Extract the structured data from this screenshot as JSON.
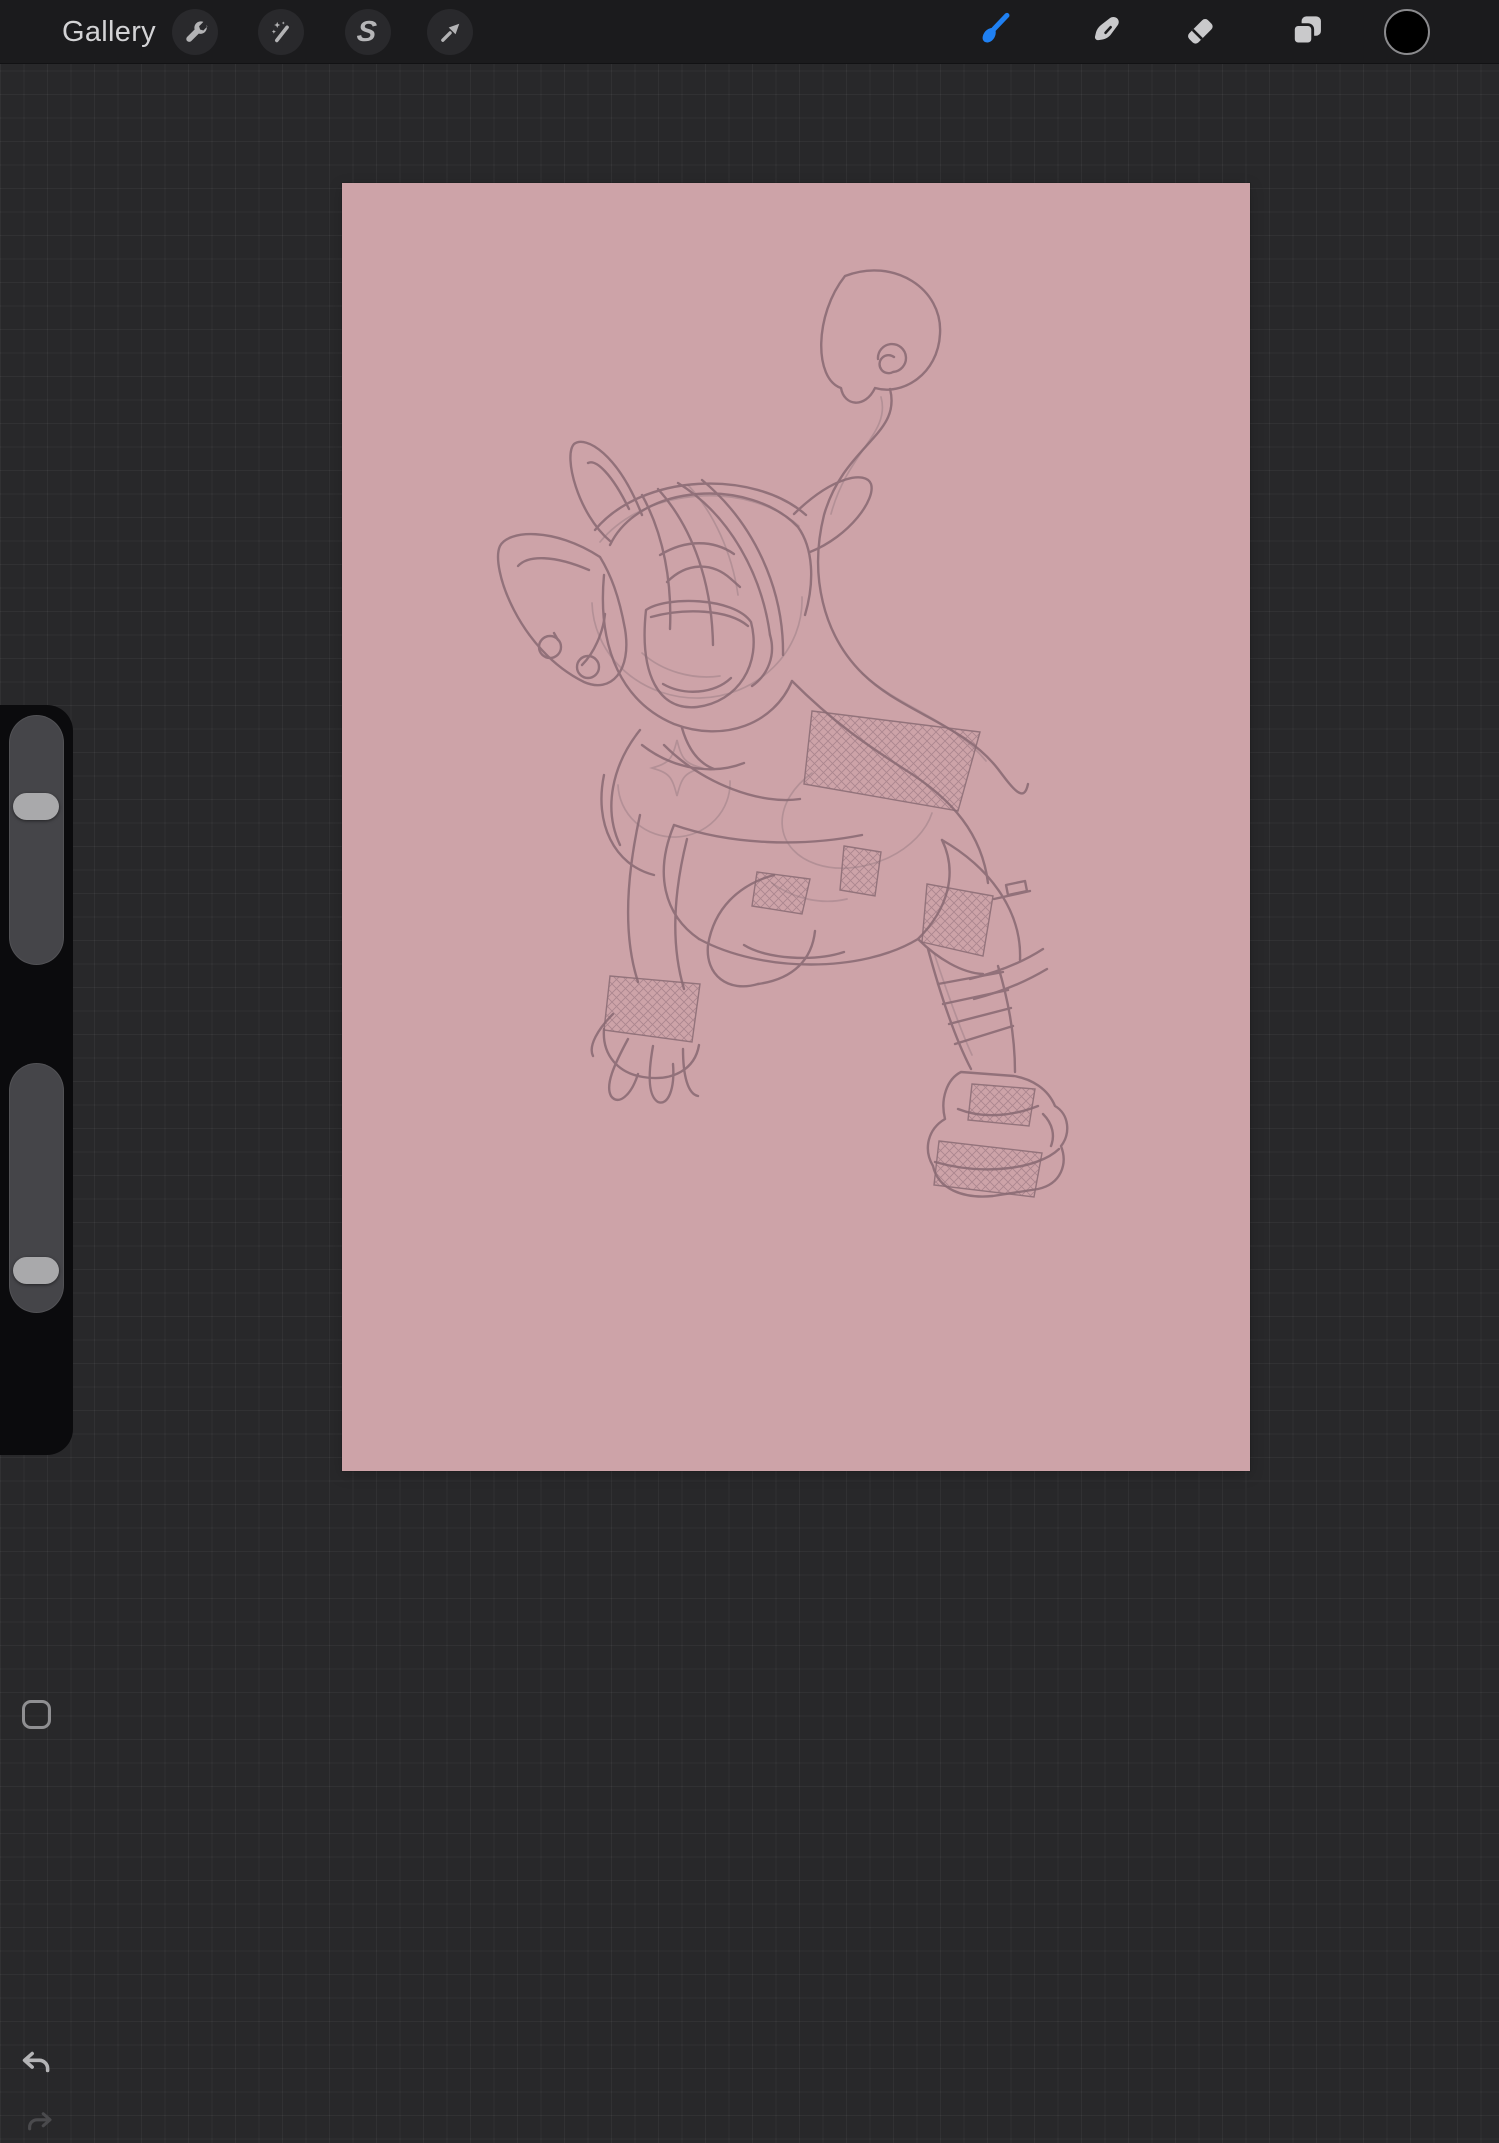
{
  "topbar": {
    "background": "#1b1b1d",
    "gallery_label": "Gallery",
    "left_tools": [
      {
        "id": "actions",
        "icon": "wrench-icon"
      },
      {
        "id": "adjustments",
        "icon": "magic-wand-icon"
      },
      {
        "id": "selection",
        "icon": "s-ribbon-icon",
        "glyph": "S"
      },
      {
        "id": "transform",
        "icon": "move-arrow-icon"
      }
    ],
    "right_tools": [
      {
        "id": "paint",
        "icon": "paintbrush-icon",
        "active": true,
        "accent": "#1f80f2"
      },
      {
        "id": "smudge",
        "icon": "smudge-finger-icon",
        "active": false
      },
      {
        "id": "erase",
        "icon": "eraser-icon",
        "active": false
      },
      {
        "id": "layers",
        "icon": "layers-icon",
        "active": false
      },
      {
        "id": "color",
        "icon": "color-swatch-circle",
        "value": "#000000"
      }
    ]
  },
  "sidebar": {
    "background": "#0b0b0d",
    "brush_size_slider": {
      "handle_position_percent": 35
    },
    "modify_button": {
      "icon": "rounded-square-icon"
    },
    "opacity_slider": {
      "handle_position_percent": 87
    },
    "undo_button": {
      "icon": "undo-arrow-icon",
      "enabled": true
    },
    "redo_button": {
      "icon": "redo-arrow-icon",
      "enabled": false
    }
  },
  "canvas": {
    "background_color": "#cda3a8",
    "sketch_line_color": "#8a6b74",
    "content_description": "rough pencil sketch of a chibi imp character: large pointed ears with ball earrings, headband, closed eye, open laughing mouth, star ornament on chest, long curling tail ending in a swirled spade, arm reaching down with fishnet glove, crosshatched shorts, extended leg with knee pad, wrapped sock and chunky platform shoe"
  },
  "workspace": {
    "background": "#28282a",
    "grid_line_color": "#313133"
  }
}
